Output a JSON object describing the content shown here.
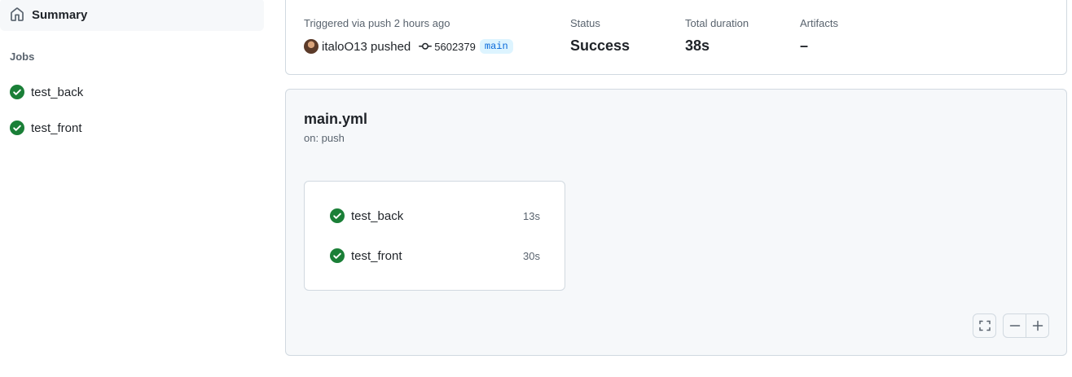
{
  "sidebar": {
    "summary_label": "Summary",
    "jobs_heading": "Jobs",
    "jobs": [
      {
        "label": "test_back",
        "status": "success"
      },
      {
        "label": "test_front",
        "status": "success"
      }
    ]
  },
  "run_summary": {
    "trigger_label": "Triggered via push 2 hours ago",
    "actor": "italoO13 pushed",
    "commit_sha": "5602379",
    "branch": "main",
    "status_label": "Status",
    "status_value": "Success",
    "duration_label": "Total duration",
    "duration_value": "38s",
    "artifacts_label": "Artifacts",
    "artifacts_value": "–"
  },
  "workflow": {
    "file_name": "main.yml",
    "trigger": "on: push",
    "jobs": [
      {
        "name": "test_back",
        "duration": "13s",
        "status": "success"
      },
      {
        "name": "test_front",
        "duration": "30s",
        "status": "success"
      }
    ]
  },
  "icons": {
    "summary": "home-icon",
    "success": "check-circle-fill-icon",
    "commit": "git-commit-icon",
    "fullscreen": "fullscreen-icon",
    "zoom_out": "minus-icon",
    "zoom_in": "plus-icon"
  },
  "colors": {
    "success": "#1a7f37",
    "link": "#0969da",
    "branch_bg": "#ddf4ff",
    "muted_text": "#59636e",
    "border": "#d1d9e0",
    "canvas": "#f6f8fa"
  }
}
